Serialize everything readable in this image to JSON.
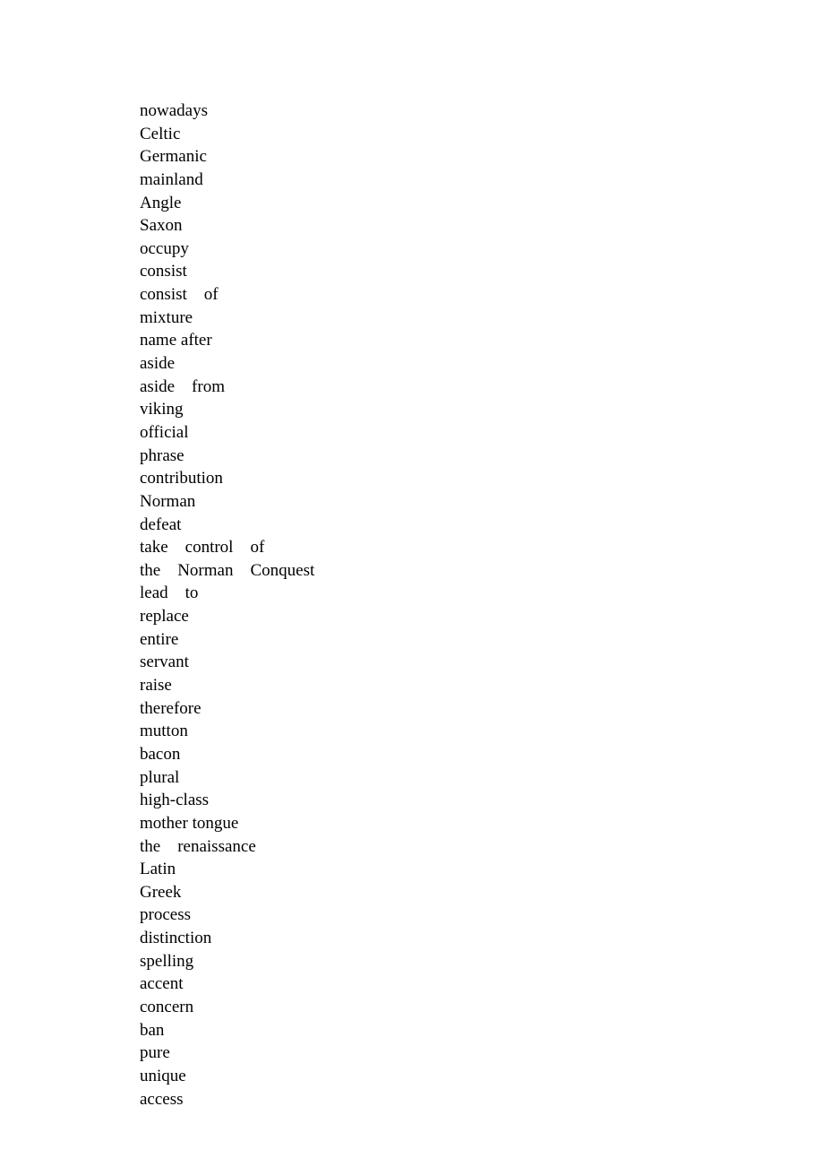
{
  "words": [
    "nowadays",
    "Celtic",
    "Germanic",
    "mainland",
    "Angle",
    "Saxon",
    "occupy",
    "consist",
    "consist    of",
    "mixture",
    "name after",
    "aside",
    "aside    from",
    "viking",
    "official",
    "phrase",
    "contribution",
    "Norman",
    "defeat",
    "take    control    of",
    "the    Norman    Conquest",
    "lead    to",
    "replace",
    "entire",
    "servant",
    "raise",
    "therefore",
    "mutton",
    "bacon",
    "plural",
    "high-class",
    "mother tongue",
    "the    renaissance",
    "Latin",
    "Greek",
    "process",
    "distinction",
    "spelling",
    "accent",
    "concern",
    "ban",
    "pure",
    "unique",
    "access"
  ]
}
